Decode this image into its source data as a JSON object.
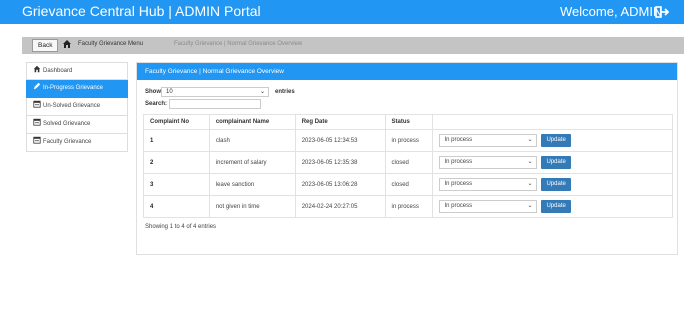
{
  "topbar": {
    "title": "Grievance Central Hub | ADMIN Portal",
    "welcome": "Welcome, ADMIN",
    "logout_icon": "logout-icon"
  },
  "breadcrumb": {
    "back_label": "Back",
    "home_icon": "home-icon",
    "menu_label": "Faculty Grievance Menu",
    "current_label": "Faculty Grievance | Normal Grievance Overview"
  },
  "sidebar": {
    "items": [
      {
        "label": "Dashboard",
        "icon": "home-icon"
      },
      {
        "label": "In-Progress Grievance",
        "icon": "pencil-icon"
      },
      {
        "label": "Un-Solved Grievance",
        "icon": "calendar-icon"
      },
      {
        "label": "Solved Grievance",
        "icon": "calendar-icon"
      },
      {
        "label": "Faculty Grievance",
        "icon": "calendar-icon"
      }
    ],
    "active_index": 1
  },
  "panel": {
    "heading": "Faculty Grievance | Normal Grievance Overview",
    "show_label": "Show",
    "entries_value": "10",
    "entries_label": "entries",
    "search_label": "Search:",
    "search_value": "",
    "columns": [
      "Complaint No",
      "complainant Name",
      "Reg Date",
      "Status",
      ""
    ],
    "rows": [
      {
        "no": "1",
        "name": "clash",
        "date": "2023-06-05 12:34:53",
        "status": "in process",
        "select": "In process",
        "action": "Update"
      },
      {
        "no": "2",
        "name": "increment of salary",
        "date": "2023-06-05 12:35:38",
        "status": "closed",
        "select": "In process",
        "action": "Update"
      },
      {
        "no": "3",
        "name": "leave sanction",
        "date": "2023-06-05 13:06:28",
        "status": "closed",
        "select": "In process",
        "action": "Update"
      },
      {
        "no": "4",
        "name": "not given in time",
        "date": "2024-02-24 20:27:05",
        "status": "in process",
        "select": "In process",
        "action": "Update"
      }
    ],
    "footer": "Showing 1 to 4 of 4 entries"
  },
  "colors": {
    "accent": "#2196f3",
    "button": "#337ab7",
    "crumb_bg": "#c4c4c4"
  }
}
